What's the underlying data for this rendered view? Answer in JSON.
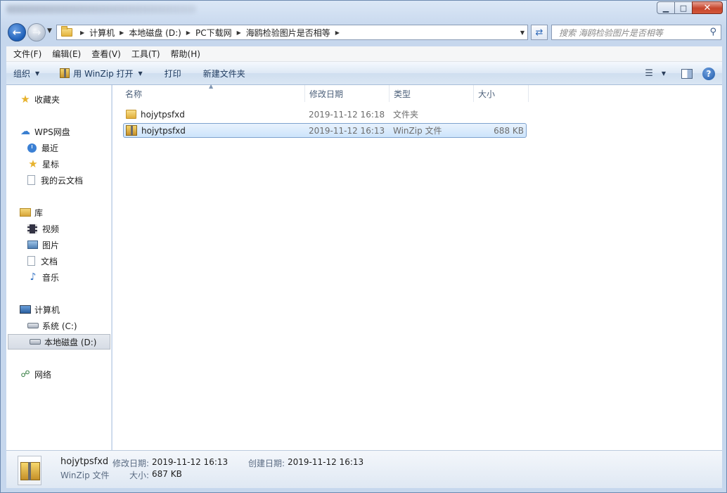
{
  "titlebar": {
    "min_icon": "minimize-icon",
    "max_icon": "maximize-icon",
    "close_icon": "close-icon",
    "min_glyph": "▁",
    "max_glyph": "□",
    "close_glyph": "✕"
  },
  "address": {
    "breadcrumbs": [
      "计算机",
      "本地磁盘 (D:)",
      "PC下载网",
      "海鸥检验图片是否相等"
    ],
    "search_placeholder": "搜索 海鸥检验图片是否相等"
  },
  "menu": [
    "文件(F)",
    "编辑(E)",
    "查看(V)",
    "工具(T)",
    "帮助(H)"
  ],
  "toolbar": {
    "organize": "组织",
    "open_winzip": "用 WinZip 打开",
    "print": "打印",
    "new_folder": "新建文件夹"
  },
  "nav": {
    "favorites": "收藏夹",
    "wps": "WPS网盘",
    "recent": "最近",
    "starred": "星标",
    "my_cloud_docs": "我的云文档",
    "library": "库",
    "video": "视频",
    "pictures": "图片",
    "documents": "文档",
    "music": "音乐",
    "computer": "计算机",
    "system_c": "系统 (C:)",
    "local_d": "本地磁盘 (D:)",
    "network": "网络"
  },
  "columns": {
    "name": "名称",
    "modified": "修改日期",
    "type": "类型",
    "size": "大小"
  },
  "files": [
    {
      "name": "hojytpsfxd",
      "modified": "2019-11-12 16:18",
      "type": "文件夹",
      "size": "",
      "icon": "folder-icon",
      "selected": false
    },
    {
      "name": "hojytpsfxd",
      "modified": "2019-11-12 16:13",
      "type": "WinZip 文件",
      "size": "688 KB",
      "icon": "winzip-file-icon",
      "selected": true
    }
  ],
  "details": {
    "name": "hojytpsfxd",
    "type": "WinZip 文件",
    "modified_label": "修改日期:",
    "modified_value": "2019-11-12 16:13",
    "created_label": "创建日期:",
    "created_value": "2019-11-12 16:13",
    "size_label": "大小:",
    "size_value": "687 KB"
  }
}
